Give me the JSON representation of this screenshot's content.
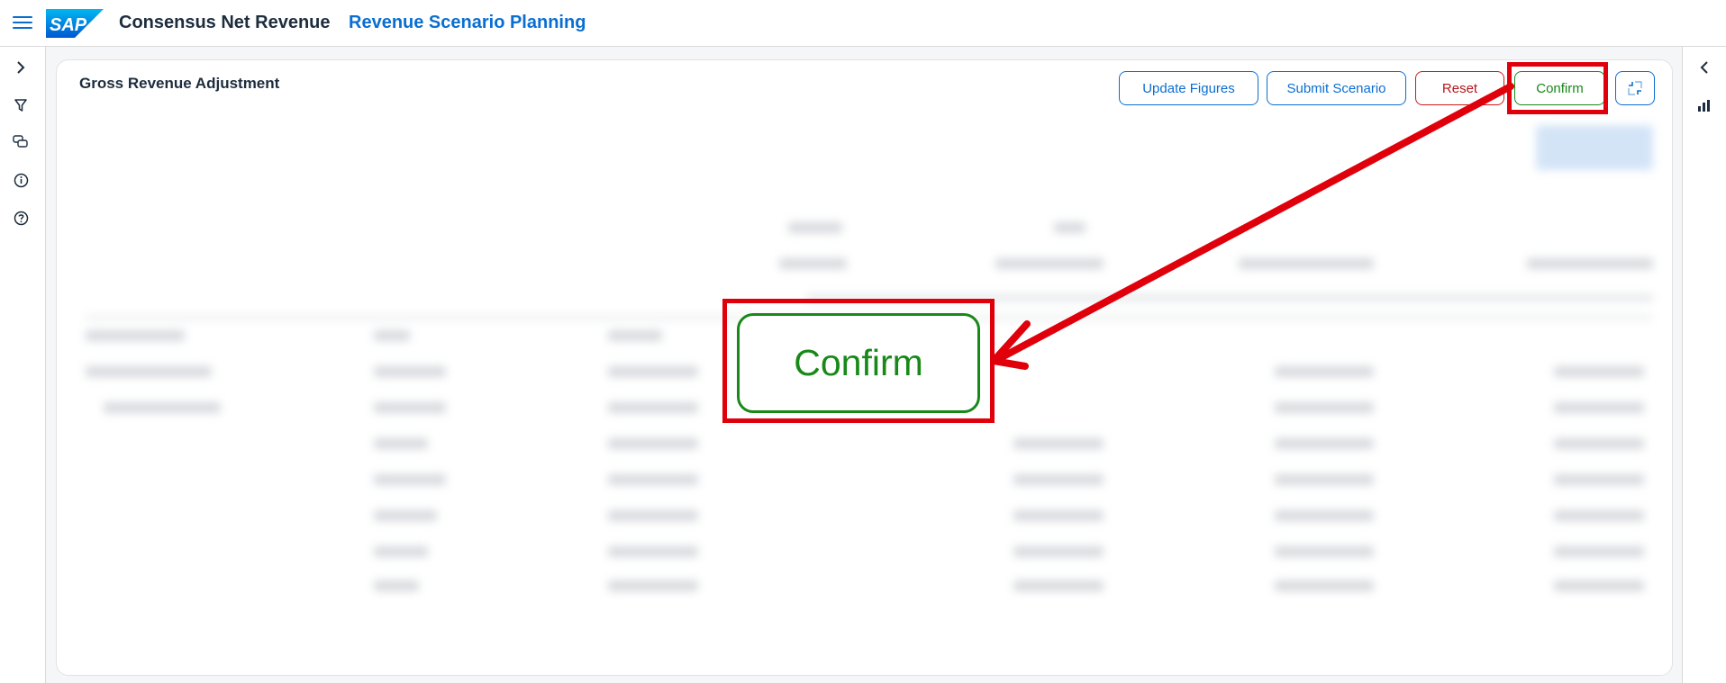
{
  "shell": {
    "app_title": "Consensus Net Revenue",
    "app_subtitle": "Revenue Scenario Planning",
    "logo_text": "SAP",
    "accent_color": "#0a6ed1"
  },
  "left_rail": {
    "icons": [
      "chevron-right-icon",
      "filter-icon",
      "comments-icon",
      "info-icon",
      "help-icon"
    ]
  },
  "right_rail": {
    "icons": [
      "chevron-left-icon",
      "bar-chart-icon"
    ]
  },
  "card": {
    "title": "Gross Revenue Adjustment",
    "buttons": {
      "update": "Update Figures",
      "submit": "Submit Scenario",
      "reset": "Reset",
      "confirm": "Confirm"
    },
    "exit_fullscreen_icon": "exit-fullscreen-icon"
  },
  "annotation": {
    "zoom_label": "Confirm",
    "highlight_color": "#e0000b"
  }
}
